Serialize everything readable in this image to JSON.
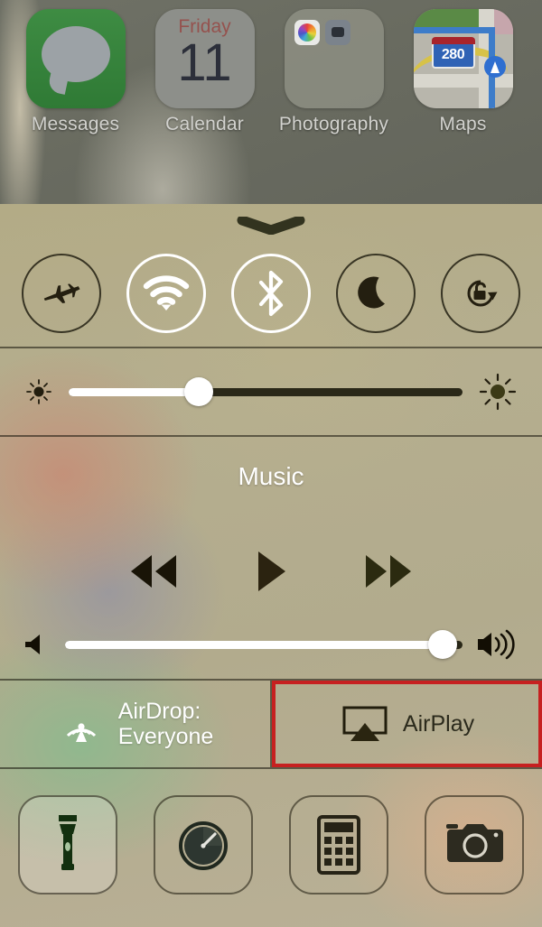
{
  "home_screen": {
    "apps": [
      {
        "label": "Messages",
        "icon": "messages-icon"
      },
      {
        "label": "Calendar",
        "icon": "calendar-icon",
        "day": "Friday",
        "date": "11"
      },
      {
        "label": "Photography",
        "icon": "folder-icon",
        "contents": [
          "photos-icon",
          "camera-icon"
        ]
      },
      {
        "label": "Maps",
        "icon": "maps-icon",
        "highway": "280"
      }
    ]
  },
  "control_center": {
    "grabber": "grabber-handle",
    "toggles": [
      {
        "name": "airplane-mode",
        "label": "Airplane Mode",
        "state": "off"
      },
      {
        "name": "wifi",
        "label": "Wi-Fi",
        "state": "on"
      },
      {
        "name": "bluetooth",
        "label": "Bluetooth",
        "state": "on"
      },
      {
        "name": "do-not-disturb",
        "label": "Do Not Disturb",
        "state": "off"
      },
      {
        "name": "rotation-lock",
        "label": "Portrait Orientation Lock",
        "state": "off"
      }
    ],
    "brightness": {
      "label": "Brightness",
      "value": 33,
      "min_icon": "brightness-low-icon",
      "max_icon": "brightness-high-icon"
    },
    "music": {
      "title": "Music",
      "previous_label": "Previous Track",
      "play_label": "Play",
      "next_label": "Next Track",
      "volume": {
        "label": "Volume",
        "value": 95,
        "min_icon": "volume-min-icon",
        "max_icon": "volume-max-icon"
      }
    },
    "share": {
      "airdrop": {
        "title": "AirDrop:",
        "value": "Everyone",
        "icon": "airdrop-icon",
        "highlighted": false
      },
      "airplay": {
        "label": "AirPlay",
        "icon": "airplay-icon",
        "highlighted": true,
        "highlight_color": "#c62020"
      }
    },
    "shortcuts": [
      {
        "name": "flashlight",
        "label": "Flashlight",
        "active": true
      },
      {
        "name": "timer",
        "label": "Timer",
        "active": false
      },
      {
        "name": "calculator",
        "label": "Calculator",
        "active": false
      },
      {
        "name": "camera",
        "label": "Camera",
        "active": false
      }
    ]
  }
}
